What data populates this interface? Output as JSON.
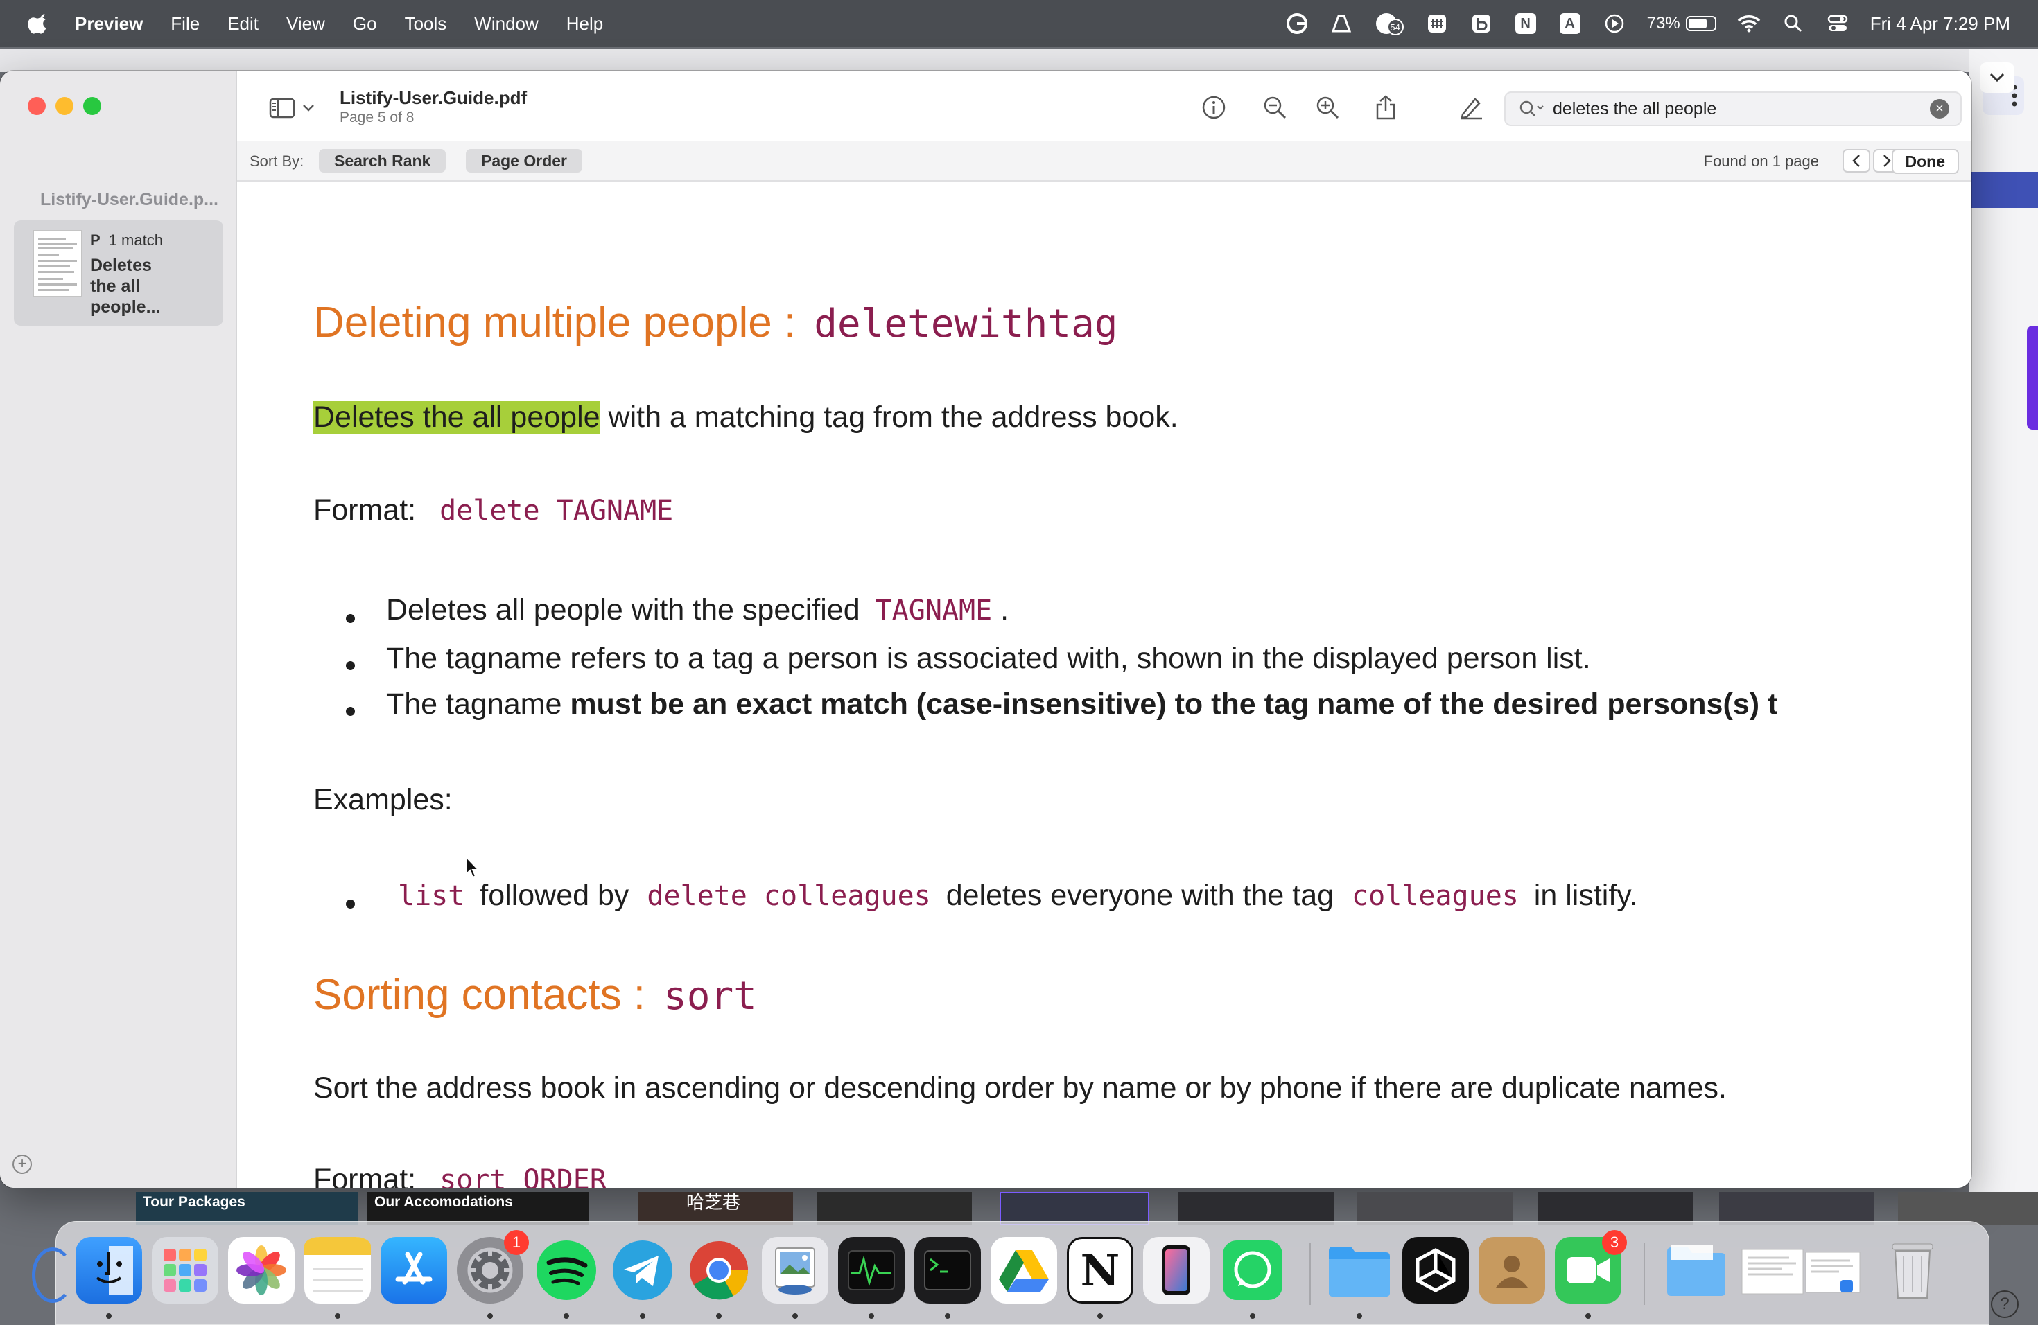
{
  "menubar": {
    "app_name": "Preview",
    "menus": [
      "File",
      "Edit",
      "View",
      "Go",
      "Tools",
      "Window",
      "Help"
    ],
    "tray_badge": "54",
    "tray_letters": {
      "n": "N",
      "a": "A"
    },
    "battery_percent": "73%",
    "battery_level": 0.73,
    "clock": "Fri 4 Apr  7:29 PM"
  },
  "sidebar": {
    "title": "Listify-User.Guide.p...",
    "result": {
      "page_letter": "P",
      "match_count": "1 match",
      "snippet": "Deletes the all people..."
    }
  },
  "toolbar": {
    "document_name": "Listify-User.Guide.pdf",
    "page_indicator": "Page 5 of 8",
    "search": {
      "value": "deletes the all people",
      "icon": "magnifier-icon"
    }
  },
  "sortbar": {
    "label": "Sort By:",
    "search_rank": "Search Rank",
    "page_order": "Page Order",
    "found_text": "Found on 1 page",
    "done": "Done"
  },
  "document": {
    "section1": {
      "heading": "Deleting multiple people :",
      "heading_code": "deletewithtag",
      "intro_highlight": "Deletes the all people",
      "intro_rest": " with a matching tag from the address book.",
      "format_label": "Format:",
      "format_code": "delete TAGNAME",
      "bullets": {
        "b1_text": "Deletes all people with the specified ",
        "b1_code": "TAGNAME",
        "b1_end": " .",
        "b2_text": "The tagname refers to a tag a person is associated with, shown in the displayed person list.",
        "b3_text": "The tagname ",
        "b3_bold": "must be an exact match (case-insensitive) to the tag name of the desired persons(s) t"
      },
      "examples_label": "Examples:",
      "example": {
        "code1": "list",
        "t1": " followed by ",
        "code2": "delete colleagues",
        "t2": " deletes everyone with the tag ",
        "code3": "colleagues",
        "t3": " in listify."
      }
    },
    "section2": {
      "heading": "Sorting contacts :",
      "heading_code": "sort",
      "intro": "Sort the address book in ascending or descending order by name or by phone if there are duplicate names.",
      "format_label": "Format:",
      "format_code": "sort ORDER"
    }
  },
  "dock": {
    "thumbnails": {
      "t1": "Tour Packages",
      "t2": "Our Accomodations",
      "t3": "哈芝巷"
    },
    "apps": [
      "Finder",
      "Launchpad",
      "Photos",
      "Notes",
      "App Store",
      "System Settings",
      "Spotify",
      "Telegram",
      "Chrome",
      "Preview",
      "Activity Monitor",
      "Terminal",
      "Google Drive",
      "Notion",
      "iPhone Mirroring",
      "WhatsApp",
      "Files",
      "Codux",
      "Contacts",
      "FaceTime",
      "Downloads",
      "Recent Documents",
      "Trash"
    ],
    "settings_badge": "1",
    "facetime_badge": "3",
    "help": "?"
  },
  "colors": {
    "heading_orange": "#e07423",
    "code_maroon": "#8b1e4f",
    "search_highlight": "#a7cf3a"
  }
}
